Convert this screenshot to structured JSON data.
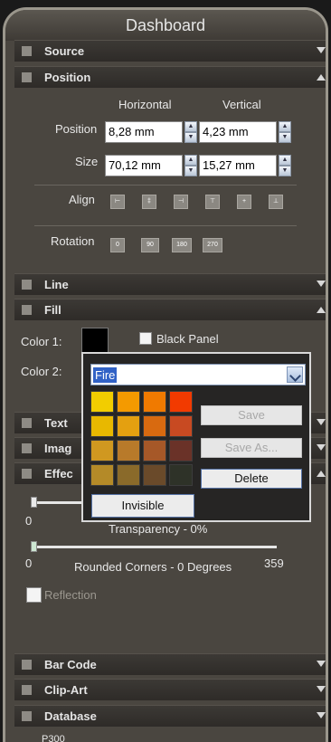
{
  "title": "Dashboard",
  "sections": {
    "source": "Source",
    "position": "Position",
    "line": "Line",
    "fill": "Fill",
    "text": "Text",
    "image": "Imag",
    "effects": "Effec",
    "barcode": "Bar Code",
    "clipart": "Clip-Art",
    "database": "Database"
  },
  "position": {
    "col_horizontal": "Horizontal",
    "col_vertical": "Vertical",
    "position_label": "Position",
    "size_label": "Size",
    "pos_h": "8,28 mm",
    "pos_v": "4,23 mm",
    "size_h": "70,12 mm",
    "size_v": "15,27 mm",
    "align_label": "Align",
    "rotation_label": "Rotation",
    "rotations": [
      "0",
      "90",
      "180",
      "270"
    ]
  },
  "fill": {
    "color1_label": "Color 1:",
    "color2_label": "Color 2:",
    "black_panel_label": "Black Panel",
    "color1": "#000000"
  },
  "palette_popup": {
    "selected_palette": "Fire",
    "save": "Save",
    "save_as": "Save As...",
    "delete": "Delete",
    "invisible": "Invisible",
    "colors": [
      "#f2cd00",
      "#f49a00",
      "#f07a00",
      "#f23a00",
      "#e8b800",
      "#e4a010",
      "#d86a10",
      "#c84a22",
      "#d09820",
      "#b87a2a",
      "#a65828",
      "#6a3228",
      "#b48a28",
      "#8a6a2a",
      "#6a4a2a",
      "#2e3228"
    ]
  },
  "effects": {
    "transparency_min": "0",
    "transparency_label": "Transparency - 0%",
    "corners_min": "0",
    "corners_max": "359",
    "corners_label": "Rounded Corners - 0 Degrees",
    "reflection_label": "Reflection"
  },
  "footer_text": "P300"
}
